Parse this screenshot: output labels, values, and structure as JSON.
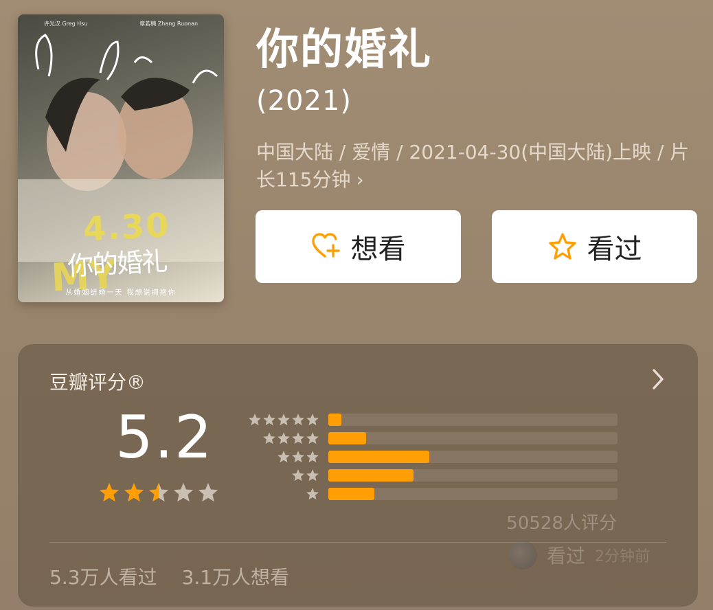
{
  "movie": {
    "title": "你的婚礼",
    "year": "(2021)",
    "meta": "中国大陆 / 爱情 / 2021-04-30(中国大陆)上映 / 片长115分钟",
    "meta_chevron": "›"
  },
  "poster": {
    "actor_left": "许光汉 Greg Hsu",
    "actor_right": "章若楠 Zhang Ruonan",
    "date_text": "4.30",
    "title_cn": "你的婚礼",
    "title_en": "MY LOVE",
    "tagline": "从婚姻结婚一天 我想说拥抱你"
  },
  "actions": {
    "want_label": "想看",
    "seen_label": "看过"
  },
  "rating": {
    "section_title": "豆瓣评分®",
    "score": "5.2",
    "stars_value": 2.5,
    "stars_max": 5,
    "distribution": [
      {
        "stars": 5,
        "percent": 4.5
      },
      {
        "stars": 4,
        "percent": 13
      },
      {
        "stars": 3,
        "percent": 35
      },
      {
        "stars": 2,
        "percent": 29.5
      },
      {
        "stars": 1,
        "percent": 16
      }
    ],
    "count_text": "50528人评分",
    "recent_action": "看过",
    "recent_time": "2分钟前",
    "seen_stat": "5.3万人看过",
    "want_stat": "3.1万人想看"
  },
  "colors": {
    "accent": "#ff9f05",
    "background": "#9c8870",
    "star_empty": "#c9bfb3"
  }
}
